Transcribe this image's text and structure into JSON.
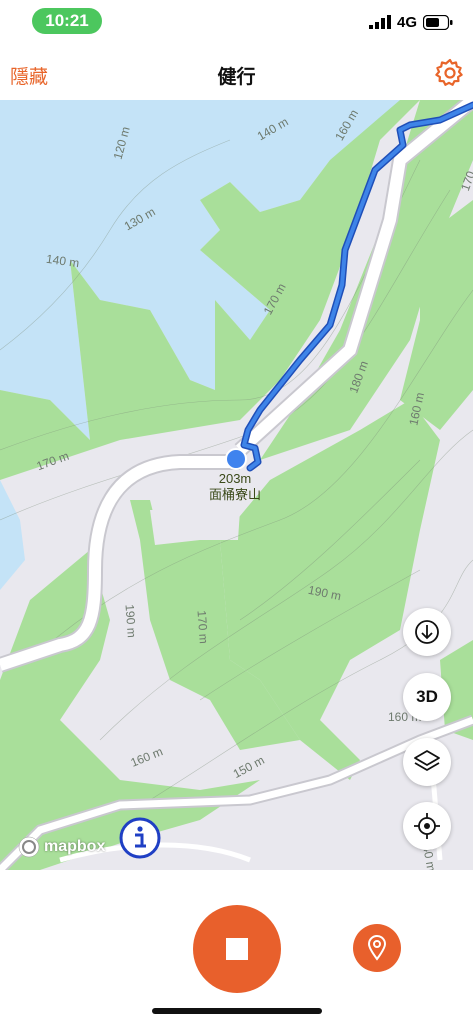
{
  "status": {
    "time": "10:21",
    "network": "4G"
  },
  "nav": {
    "left_label": "隱藏",
    "title": "健行"
  },
  "map": {
    "peak_elevation": "203m",
    "peak_name": "面桶寮山",
    "contour_labels": [
      "140 m",
      "120 m",
      "160 m",
      "130 m",
      "140 m",
      "170 m",
      "180 m",
      "170 m",
      "160 m",
      "190 m",
      "170 m",
      "190 m",
      "160 m",
      "150 m",
      "160 m",
      "140 m",
      "170"
    ],
    "attribution": "mapbox",
    "btn_3d": "3D"
  },
  "colors": {
    "accent": "#e8652a",
    "water": "#c4e3f7",
    "forest": "#a9df9a",
    "track": "#2d6fd6"
  }
}
